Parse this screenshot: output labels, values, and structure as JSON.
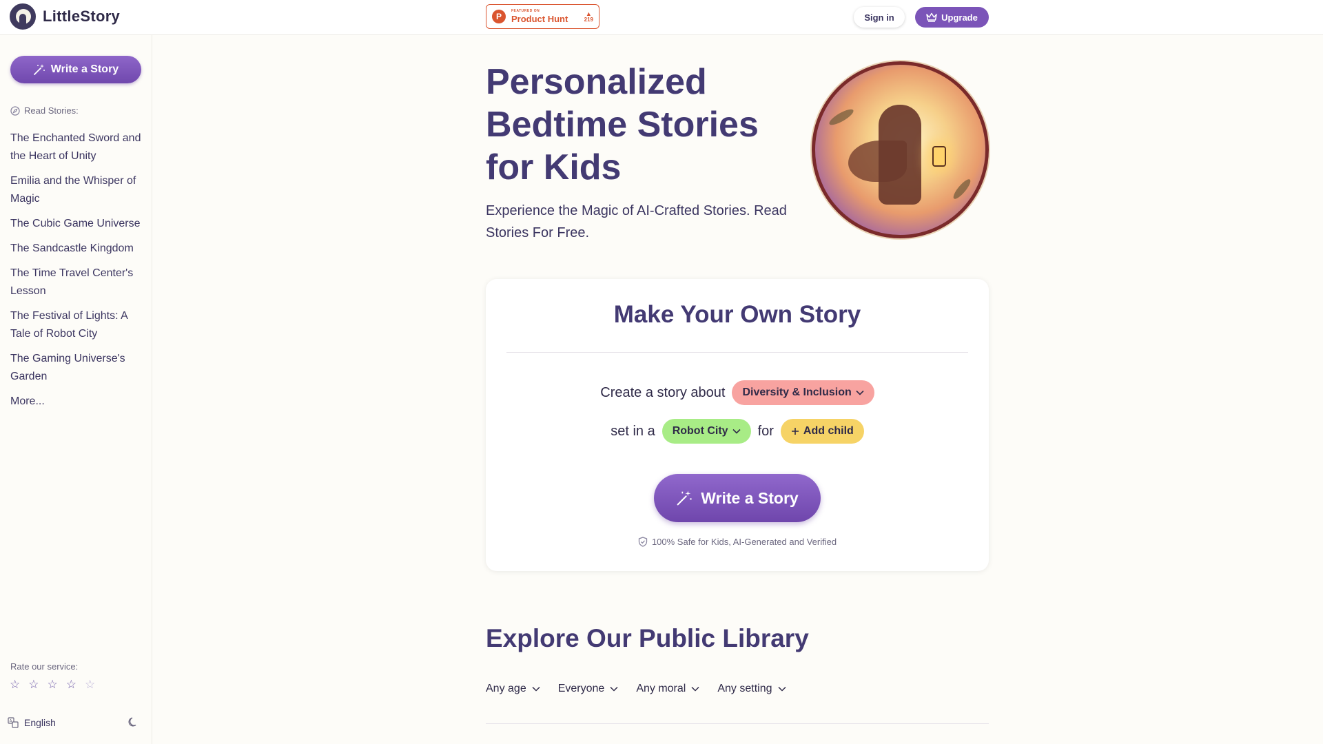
{
  "header": {
    "brand": "LittleStory",
    "product_hunt": {
      "featured": "FEATURED ON",
      "name": "Product Hunt",
      "votes": "219"
    },
    "signin_label": "Sign in",
    "upgrade_label": "Upgrade"
  },
  "sidebar": {
    "write_label": "Write a Story",
    "read_label": "Read Stories:",
    "stories": [
      "The Enchanted Sword and the Heart of Unity",
      "Emilia and the Whisper of Magic",
      "The Cubic Game Universe",
      "The Sandcastle Kingdom",
      "The Time Travel Center's Lesson",
      "The Festival of Lights: A Tale of Robot City",
      "The Gaming Universe's Garden"
    ],
    "more_label": "More...",
    "rate_label": "Rate our service:",
    "rating_stars": 5,
    "language": "English"
  },
  "hero": {
    "title": "Personalized Bedtime Stories for Kids",
    "subtitle": "Experience the Magic of AI-Crafted Stories. Read Stories For Free."
  },
  "card": {
    "title": "Make Your Own Story",
    "create_text": "Create a story about",
    "topic": "Diversity & Inclusion",
    "set_in_text": "set in a",
    "setting": "Robot City",
    "for_text": "for",
    "add_child": "Add child",
    "write_label": "Write a Story",
    "safe_note": "100% Safe for Kids, AI-Generated and Verified"
  },
  "library": {
    "title": "Explore Our Public Library",
    "filters": [
      "Any age",
      "Everyone",
      "Any moral",
      "Any setting"
    ]
  },
  "colors": {
    "primary_purple": "#7b54b8",
    "heading": "#433a73",
    "topic_pill": "#f8a3a0",
    "setting_pill": "#a8ec86",
    "child_pill": "#f6d366",
    "product_hunt": "#da552f"
  },
  "icons": {
    "logo": "child-silhouette-logo",
    "write": "magic-wand-icon",
    "upgrade": "crown-icon",
    "read": "compass-icon",
    "safe": "shield-check-icon",
    "language": "translate-icon",
    "theme": "moon-icon"
  }
}
